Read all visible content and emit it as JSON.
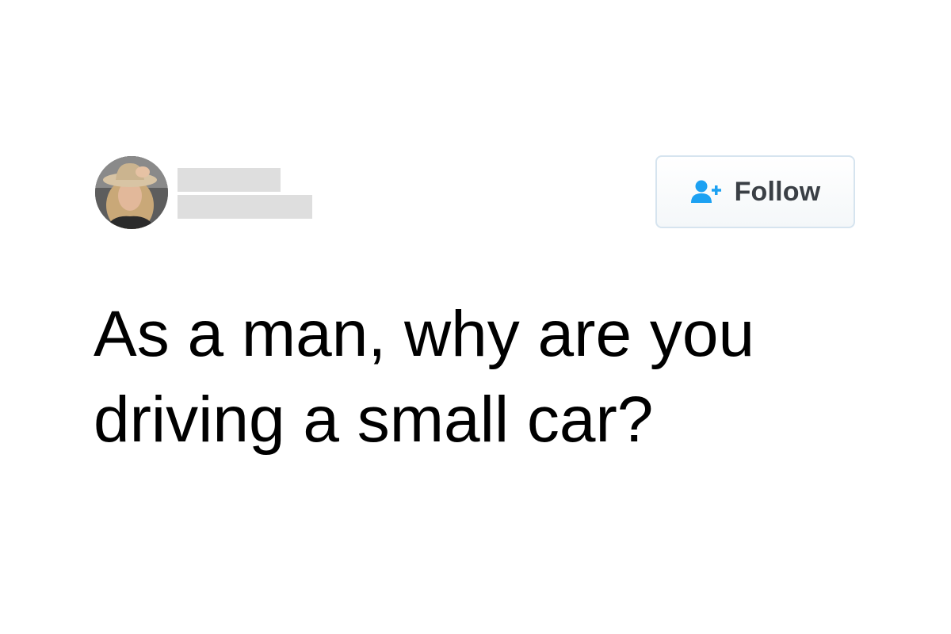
{
  "tweet": {
    "author": {
      "name": "",
      "handle": ""
    },
    "follow_button": {
      "label": "Follow",
      "icon": "add-user-icon"
    },
    "text": "As a man, why are you driving a small car?"
  },
  "colors": {
    "follow_icon": "#1da1f2",
    "follow_text": "#3a3f45",
    "redaction": "#dedede",
    "button_border": "#d6e4ef"
  }
}
